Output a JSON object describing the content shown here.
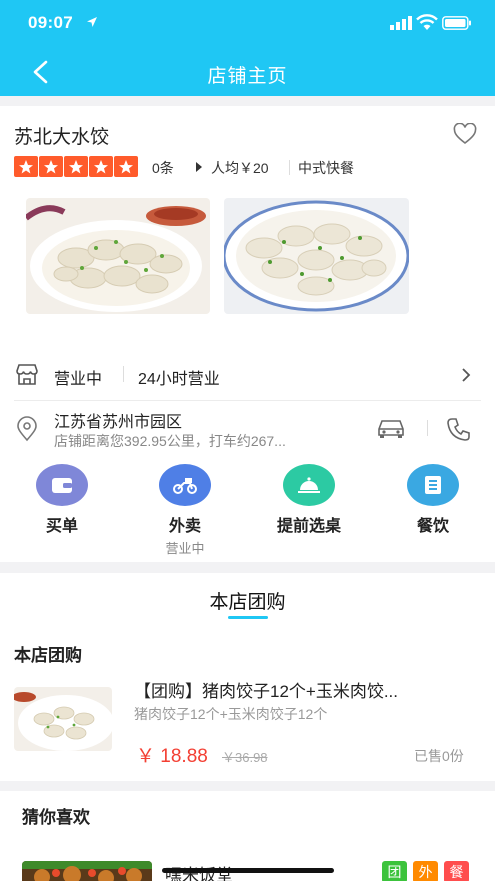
{
  "status_bar": {
    "time": "09:07"
  },
  "nav": {
    "title": "店铺主页"
  },
  "shop": {
    "name": "苏北大水饺",
    "rating_stars": 5,
    "review_count": "0条",
    "avg_price": "人均￥20",
    "cuisine": "中式快餐",
    "business_status": "营业中",
    "hours": "24小时营业",
    "address": "江苏省苏州市园区",
    "distance": "店铺距离您392.95公里，打车约267..."
  },
  "actions": [
    {
      "label": "买单",
      "sub": ""
    },
    {
      "label": "外卖",
      "sub": "营业中"
    },
    {
      "label": "提前选桌",
      "sub": ""
    },
    {
      "label": "餐饮",
      "sub": ""
    }
  ],
  "group_buy": {
    "tab_label": "本店团购",
    "section_title": "本店团购",
    "deal": {
      "title": "【团购】猪肉饺子12个+玉米肉饺...",
      "desc": "猪肉饺子12个+玉米肉饺子12个",
      "price": "￥ 18.88",
      "old_price": "￥36.98",
      "sold": "已售0份"
    }
  },
  "recommend": {
    "title": "猜你喜欢",
    "item_name": "嘿米饭堂",
    "tags": [
      {
        "label": "团",
        "color": "#3cc33c"
      },
      {
        "label": "外",
        "color": "#ff8a00"
      },
      {
        "label": "餐",
        "color": "#ff4d4d"
      }
    ]
  },
  "colors": {
    "accent": "#1fc7f4",
    "star": "#ff5b2b",
    "price": "#f33f33"
  }
}
